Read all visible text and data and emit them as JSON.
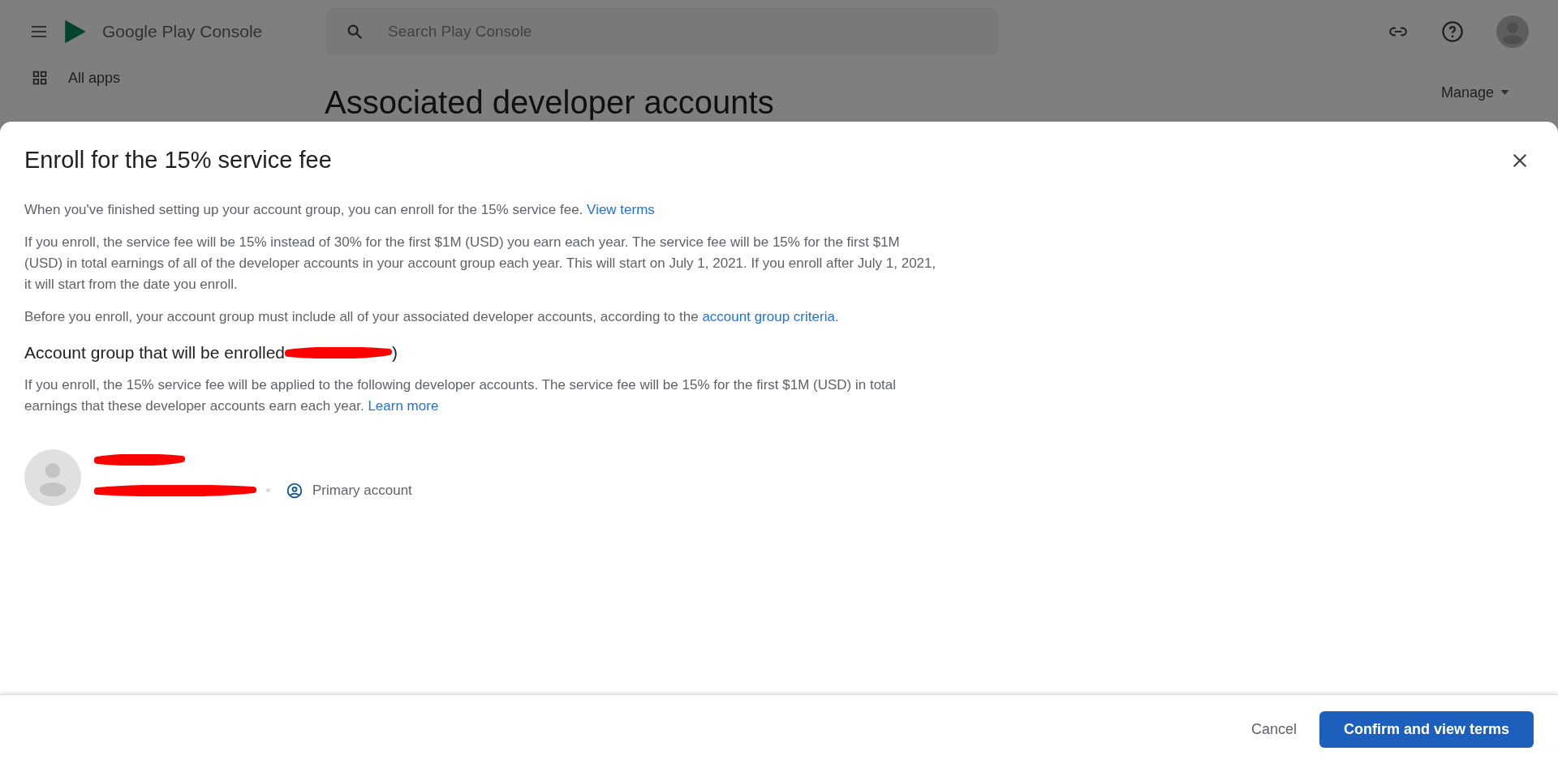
{
  "top_bar": {
    "product": "Google Play Console",
    "search": {
      "placeholder": "Search Play Console"
    }
  },
  "sidebar": {
    "items": [
      {
        "label": "All apps",
        "selected": false
      }
    ]
  },
  "page": {
    "title": "Associated developer accounts",
    "menu": "Manage"
  },
  "dialog": {
    "title": "Enroll for the 15% service fee",
    "paragraphs": [
      {
        "text": "When you've finished setting up your account group, you can enroll for the 15% service fee.",
        "link": "View terms"
      },
      {
        "text": "If you enroll, the service fee will be 15% instead of 30% for the first $1M (USD) you earn each year. The service fee will be 15% for the first $1M (USD) in total earnings of all of the developer accounts in your account group each year. This will start on July 1, 2021. If you enroll after July 1, 2021, it will start from the date you enroll."
      },
      {
        "text": "Before you enroll, your account group must include all of your associated developer accounts, according to the",
        "link": "account group criteria",
        "after": "."
      }
    ],
    "section": {
      "title": "Account group that will be enrolled",
      "title_end": ")",
      "text": "If you enroll, the 15% service fee will be applied to the following developer accounts. The service fee will be 15% for the first $1M (USD) in total earnings that these developer accounts earn each year.",
      "link": "Learn more"
    },
    "accounts": [
      {
        "badge": "Primary account"
      }
    ],
    "buttons": [
      {
        "label": "Cancel",
        "kind": "text"
      },
      {
        "label": "Confirm and view terms",
        "kind": "primary"
      }
    ]
  }
}
